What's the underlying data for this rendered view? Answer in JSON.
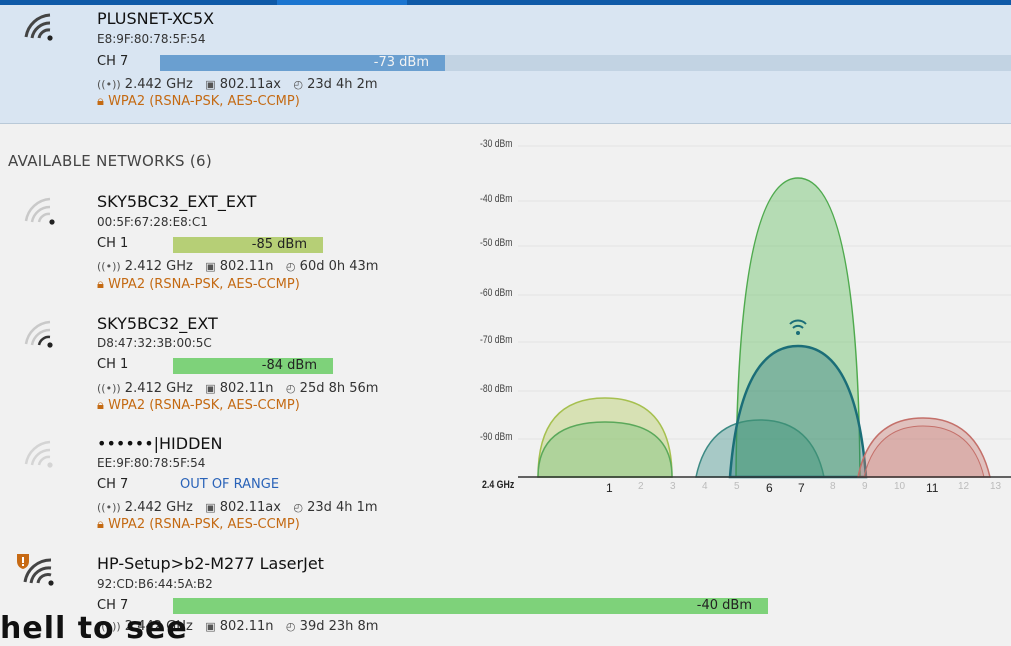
{
  "connected": {
    "name": "PLUSNET-XC5X",
    "mac": "E8:9F:80:78:5F:54",
    "channel": "CH 7",
    "signal": "-73 dBm",
    "frequency": "2.442 GHz",
    "standard": "802.11ax",
    "uptime": "23d 4h 2m",
    "security": "WPA2 (RSNA-PSK, AES-CCMP)"
  },
  "available_title": "AVAILABLE NETWORKS (6)",
  "networks": [
    {
      "name": "SKY5BC32_EXT_EXT",
      "mac": "00:5F:67:28:E8:C1",
      "channel": "CH 1",
      "signal": "-85 dBm",
      "frequency": "2.412 GHz",
      "standard": "802.11n",
      "uptime": "60d 0h 43m",
      "security": "WPA2 (RSNA-PSK, AES-CCMP)"
    },
    {
      "name": "SKY5BC32_EXT",
      "mac": "D8:47:32:3B:00:5C",
      "channel": "CH 1",
      "signal": "-84 dBm",
      "frequency": "2.412 GHz",
      "standard": "802.11n",
      "uptime": "25d 8h 56m",
      "security": "WPA2 (RSNA-PSK, AES-CCMP)"
    },
    {
      "name": "••••••|HIDDEN",
      "mac": "EE:9F:80:78:5F:54",
      "channel": "CH 7",
      "signal": "OUT OF RANGE",
      "frequency": "2.442 GHz",
      "standard": "802.11ax",
      "uptime": "23d 4h 1m",
      "security": "WPA2 (RSNA-PSK, AES-CCMP)"
    },
    {
      "name": "HP-Setup>b2-M277 LaserJet",
      "mac": "92:CD:B6:44:5A:B2",
      "channel": "CH 7",
      "signal": "-40 dBm",
      "frequency": "2.442 GHz",
      "standard": "802.11n",
      "uptime": "39d 23h 8m"
    }
  ],
  "chart": {
    "y_labels": [
      "-30 dBm",
      "-40 dBm",
      "-50 dBm",
      "-60 dBm",
      "-70 dBm",
      "-80 dBm",
      "-90 dBm"
    ],
    "band_label": "2.4 GHz",
    "x_labels": [
      "1",
      "2",
      "3",
      "4",
      "5",
      "6",
      "7",
      "8",
      "9",
      "10",
      "11",
      "12",
      "13"
    ],
    "colors": {
      "green": "#6cc36a",
      "teal": "#1b6e78",
      "yellowgreen": "#b7cf6a",
      "red": "#c97a73"
    }
  },
  "overlay_text": "hell to see"
}
